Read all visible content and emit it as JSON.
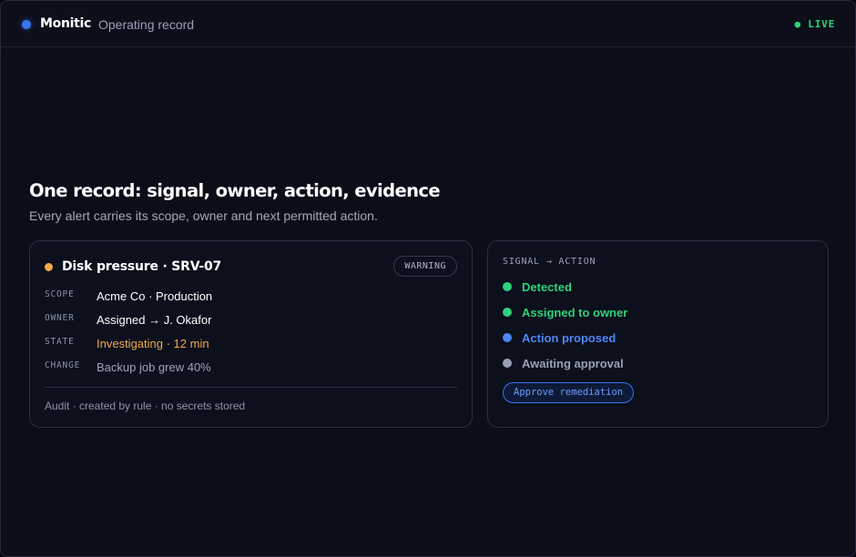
{
  "header": {
    "brand": "Monitic",
    "subtitle": "Operating record",
    "live_label": "● LIVE"
  },
  "hero": {
    "title": "One record: signal, owner, action, evidence",
    "subtitle": "Every alert carries its scope, owner and next permitted action."
  },
  "alert": {
    "title": "Disk pressure · SRV-07",
    "status_dot_color": "#f2a94a",
    "badge": "WARNING",
    "fields": [
      {
        "key": "SCOPE",
        "value": "Acme Co · Production"
      },
      {
        "key": "OWNER",
        "value": "Assigned → J. Okafor"
      },
      {
        "key": "STATE",
        "value": "Investigating · 12 min"
      },
      {
        "key": "CHANGE",
        "value": "Backup job grew 40%"
      }
    ],
    "audit": "Audit · created by rule · no secrets stored"
  },
  "flow": {
    "label": "SIGNAL → ACTION",
    "steps": [
      {
        "label": "Detected",
        "color": "#2fd27a"
      },
      {
        "label": "Assigned to owner",
        "color": "#2fd27a"
      },
      {
        "label": "Action proposed",
        "color": "#4f86f7"
      },
      {
        "label": "Awaiting approval",
        "color": "#9aa0b3"
      }
    ],
    "button": "Approve remediation"
  }
}
